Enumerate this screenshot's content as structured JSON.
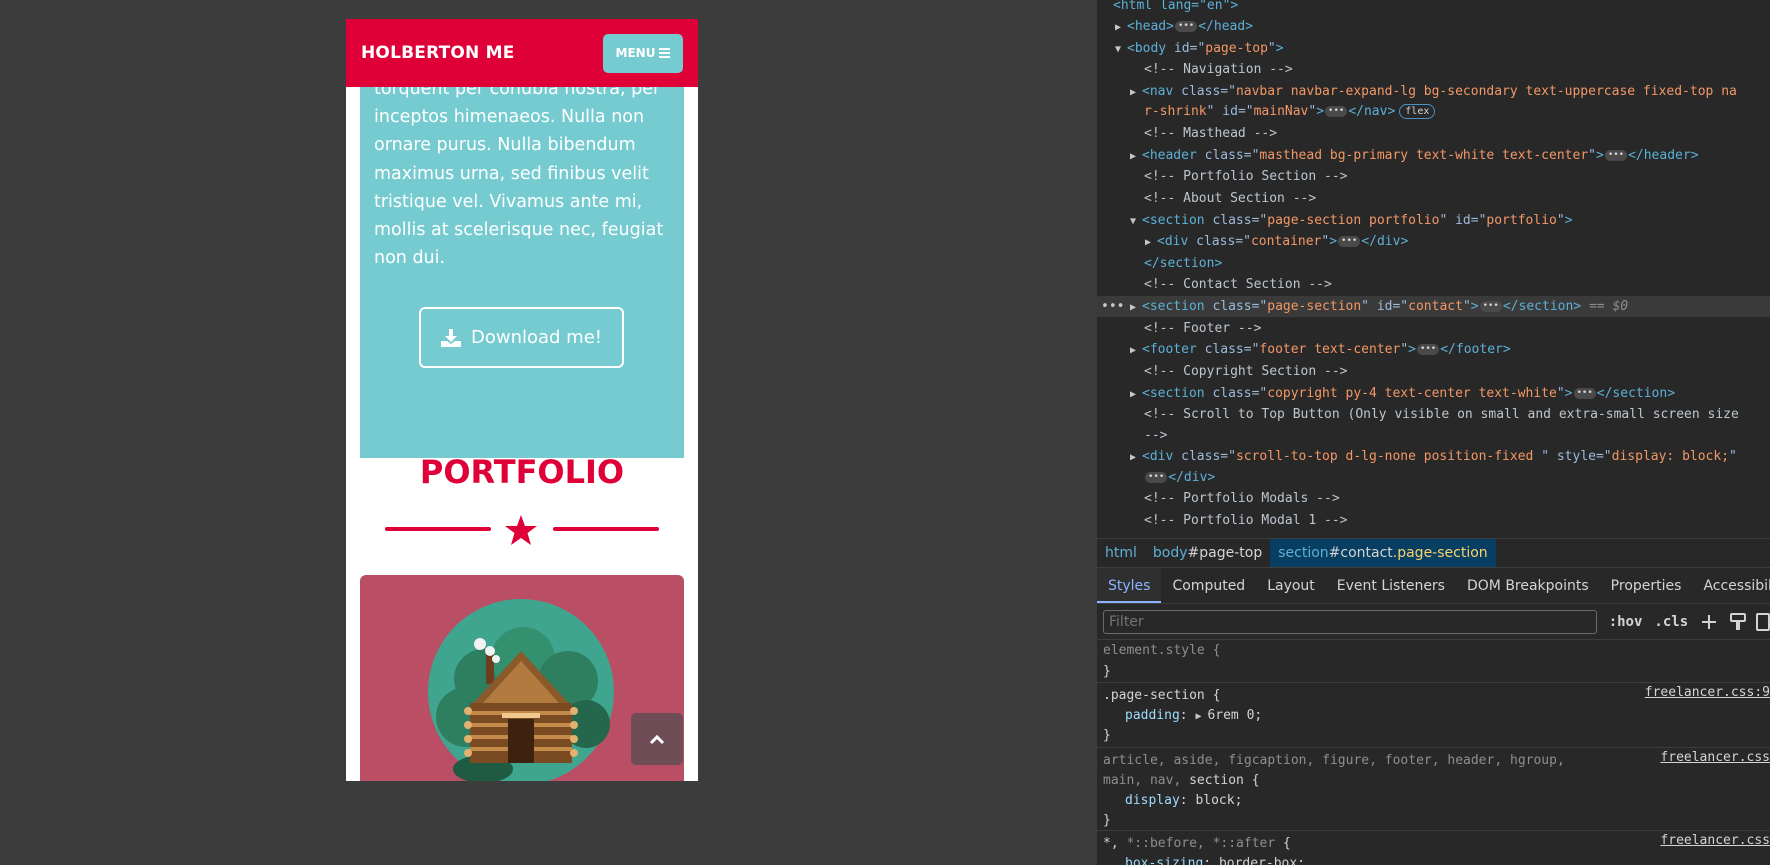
{
  "page": {
    "brand": "HOLBERTON ME",
    "menu_label": "MENU",
    "about_text": "torquent per conubia nostra, per\ninceptos himenaeos. Nulla non\nornare purus. Nulla bibendum\nmaximus urna, sed finibus velit\ntristique vel. Vivamus ante mi,\nmollis at scelerisque nec, feugiat\nnon dui.",
    "download_label": "Download me!",
    "portfolio_title": "PORTFOLIO",
    "colors": {
      "primary": "#de0037",
      "secondary": "#76cbd0",
      "card": "#ba4e65"
    }
  },
  "devtools": {
    "dom": {
      "l0": "<html lang=\"en\">",
      "l1_tag": "head",
      "l2_tag": "body",
      "l2_attr": "id",
      "l2_val": "page-top",
      "c_nav": "<!-- Navigation -->",
      "nav_tag": "nav",
      "nav_attr": "class",
      "nav_val": "navbar navbar-expand-lg bg-secondary text-uppercase fixed-top na",
      "nav_val2": "r-shrink",
      "nav_id_attr": "id",
      "nav_id_val": "mainNav",
      "nav_close": "</nav>",
      "flex_badge": "flex",
      "c_masthead": "<!-- Masthead -->",
      "header_tag": "header",
      "header_attr": "class",
      "header_val": "masthead bg-primary text-white text-center",
      "header_close": "</header>",
      "c_portfolio": "<!-- Portfolio Section -->",
      "c_about": "<!-- About Section -->",
      "sec1_tag": "section",
      "sec1_attr": "class",
      "sec1_val": "page-section portfolio",
      "sec1_id_attr": "id",
      "sec1_id_val": "portfolio",
      "div_tag": "div",
      "div_attr": "class",
      "div_val": "container",
      "div_close": "</div>",
      "sec1_close": "</section>",
      "c_contact": "<!-- Contact Section -->",
      "sec2_tag": "section",
      "sec2_attr": "class",
      "sec2_val": "page-section",
      "sec2_id_attr": "id",
      "sec2_id_val": "contact",
      "sec2_close": "</section>",
      "sec2_eq": "== $0",
      "c_footer": "<!-- Footer -->",
      "footer_tag": "footer",
      "footer_attr": "class",
      "footer_val": "footer text-center",
      "footer_close": "</footer>",
      "c_copyright": "<!-- Copyright Section -->",
      "sec3_tag": "section",
      "sec3_attr": "class",
      "sec3_val": "copyright py-4 text-center text-white",
      "sec3_close": "</section>",
      "c_scroll1": "<!-- Scroll to Top Button (Only visible on small and extra-small screen size",
      "c_scroll2": "-->",
      "div2_tag": "div",
      "div2_attr": "class",
      "div2_val": "scroll-to-top d-lg-none position-fixed ",
      "div2_style_attr": "style",
      "div2_style_val": "display: block;",
      "div2_close": "</div>",
      "c_modals": "<!-- Portfolio Modals -->",
      "c_modal1": "<!-- Portfolio Modal 1 -->"
    },
    "breadcrumb": {
      "b1": "html",
      "b2_tag": "body",
      "b2_id": "#page-top",
      "b3_tag": "section",
      "b3_id": "#contact",
      "b3_class": ".page-section"
    },
    "tabs": [
      "Styles",
      "Computed",
      "Layout",
      "Event Listeners",
      "DOM Breakpoints",
      "Properties",
      "Accessibility"
    ],
    "filter_placeholder": "Filter",
    "filter_hov": ":hov",
    "filter_cls": ".cls",
    "styles": {
      "r1_sel": "element.style {",
      "close": "}",
      "r2_sel": ".page-section {",
      "r2_src": "freelancer.css:9",
      "r2_prop": "padding",
      "r2_val": "6rem 0;",
      "r3_sel_dim": "article, aside, figcaption, figure, footer, header, hgroup,",
      "r3_sel_dim2": "main, nav, ",
      "r3_sel_match": "section",
      "r3_brace": " {",
      "r3_src": "freelancer.css",
      "r3_prop": "display",
      "r3_val": "block;",
      "r4_sel": "*, ",
      "r4_sel_dim": "*::before, *::after",
      "r4_brace": " {",
      "r4_src": "freelancer.css",
      "r4_prop": "box-sizing",
      "r4_val": "border-box;"
    }
  }
}
